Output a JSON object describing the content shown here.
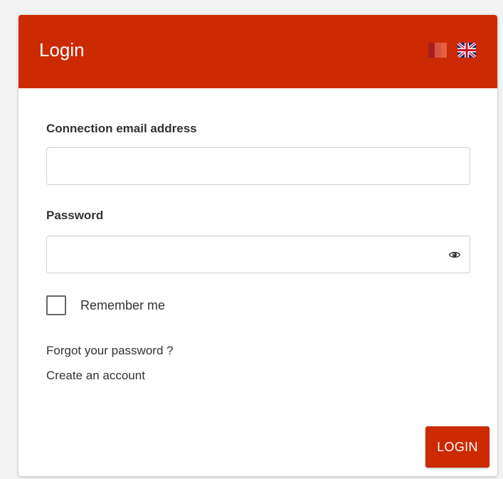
{
  "header": {
    "title": "Login",
    "languages": [
      {
        "code": "fr",
        "icon": "french-flag-icon"
      },
      {
        "code": "en",
        "icon": "uk-flag-icon"
      }
    ]
  },
  "form": {
    "email_label": "Connection email address",
    "email_value": "",
    "email_placeholder": "",
    "password_label": "Password",
    "password_value": "",
    "password_placeholder": "",
    "password_toggle_icon": "eye-icon",
    "remember_label": "Remember me",
    "remember_checked": false,
    "forgot_link": "Forgot your password ?",
    "create_link": "Create an account",
    "submit_label": "LOGIN"
  },
  "colors": {
    "accent": "#cc2a02",
    "text": "#333333",
    "page_background": "#f3f3f3"
  }
}
